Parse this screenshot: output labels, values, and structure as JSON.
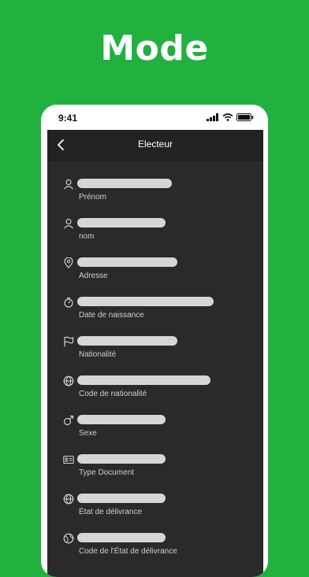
{
  "headline": "Mode",
  "status_bar": {
    "time": "9:41"
  },
  "nav": {
    "title": "Electeur",
    "back_icon": "chevron-left-icon"
  },
  "fields": [
    {
      "icon": "person-icon",
      "label": "Prénom"
    },
    {
      "icon": "person-icon",
      "label": "nom"
    },
    {
      "icon": "location-pin-icon",
      "label": "Adresse"
    },
    {
      "icon": "stopwatch-icon",
      "label": "Date de naissance"
    },
    {
      "icon": "flag-icon",
      "label": "Nationalité"
    },
    {
      "icon": "globe-icon",
      "label": "Code de nationalité"
    },
    {
      "icon": "male-symbol-icon",
      "label": "Sexe"
    },
    {
      "icon": "id-card-icon",
      "label": "Type Document"
    },
    {
      "icon": "globe-icon",
      "label": "État de délivrance"
    },
    {
      "icon": "globe-alt-icon",
      "label": "Code de l'État de délivrance"
    }
  ],
  "colors": {
    "background": "#22b03f",
    "screen": "#2a2a2a",
    "placeholder": "#d6d6d6"
  }
}
